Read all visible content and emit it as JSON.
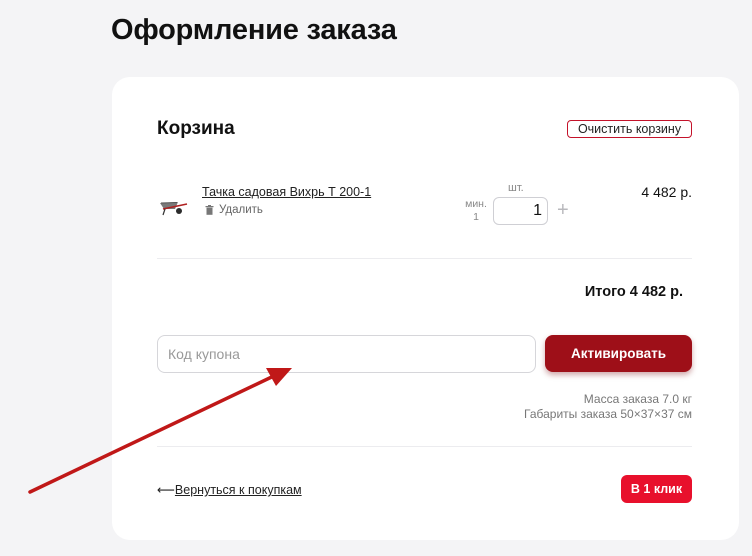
{
  "page": {
    "title": "Оформление заказа"
  },
  "cart": {
    "title": "Корзина",
    "clear_label": "Очистить корзину",
    "item": {
      "name": "Тачка садовая Вихрь Т 200-1",
      "delete_label": "Удалить",
      "unit_label": "шт.",
      "min_label": "мин.",
      "min_value": "1",
      "quantity": "1",
      "price": "4 482 р."
    },
    "total": "Итого 4 482 р."
  },
  "coupon": {
    "placeholder": "Код купона",
    "activate_label": "Активировать"
  },
  "order_info": {
    "mass": "Масса заказа 7.0 кг",
    "dimensions": "Габариты заказа 50×37×37 см"
  },
  "footer": {
    "back_arrow": "⟵",
    "back_label": "Вернуться к покупкам",
    "one_click_label": "В 1 клик"
  },
  "colors": {
    "accent_dark": "#9e0f18",
    "accent_red": "#e8102c",
    "annotation_arrow": "#c01818"
  },
  "icons": [
    "wheelbarrow-icon",
    "trash-icon",
    "plus-icon",
    "arrow-left-icon",
    "annotation-arrow"
  ]
}
